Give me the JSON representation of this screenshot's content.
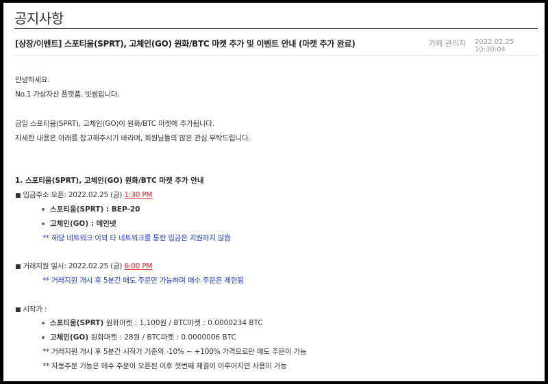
{
  "board": {
    "title": "공지사항"
  },
  "post": {
    "title": "[상장/이벤트] 스포티움(SPRT), 고체인(GO) 원화/BTC 마켓 추가 및 이벤트 안내 (마켓 추가 완료)",
    "author": "카페 관리자",
    "date": "2022.02.25 10:30:04"
  },
  "content": {
    "greeting1": "안녕하세요.",
    "greeting2": "No.1 가상자산 플랫폼, 빗썸입니다.",
    "intro1": "금일 스포티움(SPRT), 고체인(GO)이 원화/BTC 마켓에 추가됩니다.",
    "intro2": "자세한 내용은 아래를 참고해주시기 바라며, 회원님들의 많은 관심 부탁드립니다.",
    "section1_title": "1. 스포티움(SPRT), 고체인(GO) 원화/BTC 마켓 추가 안내",
    "bullet_mark": "■",
    "deposit_label": " 입금주소 오픈: 2022.02.25 (금) ",
    "deposit_time": "1:30 PM",
    "deposit_items": [
      {
        "name": "스포티움(SPRT) : BEP-20",
        "detail": ""
      },
      {
        "name": "고체인(GO) : 메인넷",
        "detail": ""
      }
    ],
    "deposit_note": "** 해당 네트워크 이외 타 네트워크를 통한 입금은 지원하지 않음",
    "trade_label": " 거래지원 일시: 2022.02.25 (금) ",
    "trade_time": "6:00 PM",
    "trade_note": "** 거래지원 개시 후 5분간 매도 주문만 가능하며 매수 주문은 제한됨",
    "start_label": " 시작가 :",
    "start_items": [
      {
        "name": "스포티움(SPRT)",
        "detail": " 원화마켓 : 1,100원 / BTC마켓 : 0.0000234 BTC"
      },
      {
        "name": "고체인(GO)",
        "detail": " 원화마켓 : 28원 / BTC마켓 : 0.0000006 BTC"
      }
    ],
    "start_note1": "** 거래지원 개시 후 5분간 시작가 기준의 -10% ~ +100% 가격으로만 매도 주문이 가능",
    "start_note2": "** 자동주문 기능은 매수 주문이 오픈된 이후 첫번째 체결이 이루어지면 사용이 가능"
  }
}
